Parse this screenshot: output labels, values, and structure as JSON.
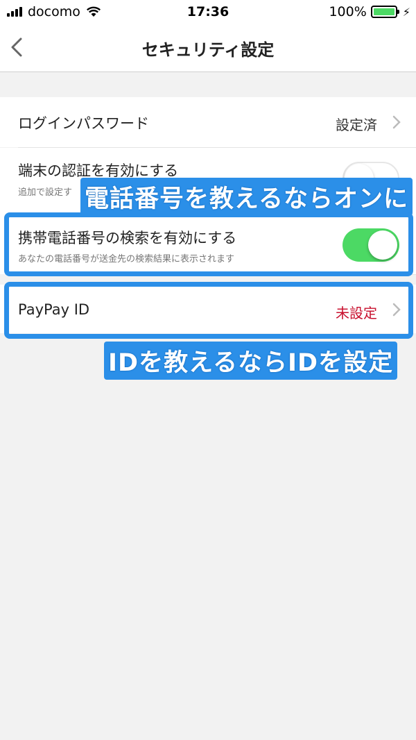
{
  "status_bar": {
    "carrier": "docomo",
    "time": "17:36",
    "battery": "100%"
  },
  "nav": {
    "title": "セキュリティ設定"
  },
  "rows": [
    {
      "label": "ログインパスワード",
      "value": "設定済"
    },
    {
      "label": "端末の認証を有効にする",
      "sub": "追加で設定す",
      "toggle": false
    },
    {
      "label": "携帯電話番号の検索を有効にする",
      "sub": "あなたの電話番号が送金先の検索結果に表示されます",
      "toggle": true
    },
    {
      "label": "PayPay ID",
      "value": "未設定"
    }
  ],
  "annotations": {
    "phone_caption": "電話番号を教えるならオンに",
    "id_caption": "IDを教えるならIDを設定"
  },
  "colors": {
    "accent_blue": "#2b8fe8",
    "toggle_green": "#4cd964",
    "unset_red": "#c8102e"
  }
}
